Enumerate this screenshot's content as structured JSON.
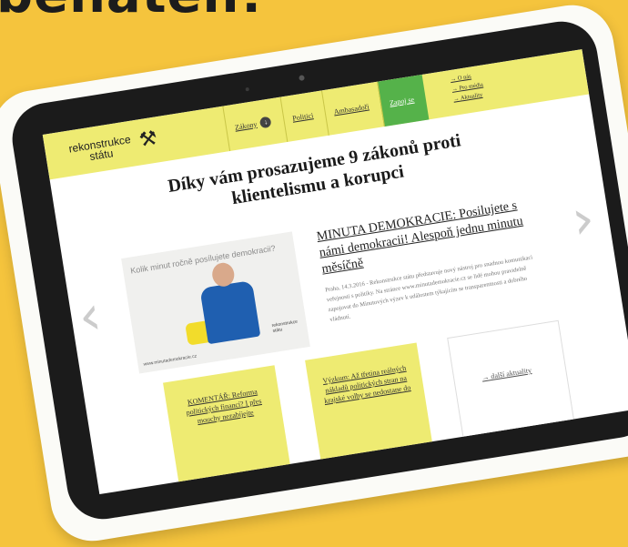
{
  "bg_heading": "benaten!",
  "logo": {
    "line1": "rekonstrukce",
    "line2": "státu"
  },
  "nav": {
    "zakony": "Zákony",
    "politici": "Politici",
    "ambasadori": "Ambasadoři",
    "zapoj_se": "Zapoj se"
  },
  "sublinks": [
    "→ O nás",
    "→ Pro média",
    "→ Aktuality"
  ],
  "headline": "Díky vám prosazujeme 9 zákonů proti klientelismu a korupci",
  "photo": {
    "text": "Kolik minut ročně posílujete demokracii?",
    "logo": "rekonstrukce státu",
    "url": "www.minutademokracie.cz"
  },
  "article": {
    "title": "MINUTA DEMOKRACIE: Posilujete s námi demokracii! Alespoň jednu minutu měsíčně",
    "body": "Praha, 14.3.2016 - Rekonstrukce státu představuje nový nástroj pro snadnou komunikaci veřejnosti s politiky. Na stránce www.minutademokracie.cz se lidé mohou pravidelně zapojovat do Minutových výzev k událostem týkajícím se transparentnosti a dobrého vládnutí."
  },
  "cards": {
    "komentar": "KOMENTÁŘ: Reforma politických financí? I přes mouchy nezabíjejte",
    "vyzkum": "Výzkum: Až třetina reálných nákladů politických stran na krajské volby se nedostane do"
  },
  "more_link": "→ další aktuality",
  "colors": {
    "background": "#f5c43d",
    "bezel": "#1b1b1b",
    "topbar": "#eeeb72",
    "accent_green": "#55b24a"
  }
}
